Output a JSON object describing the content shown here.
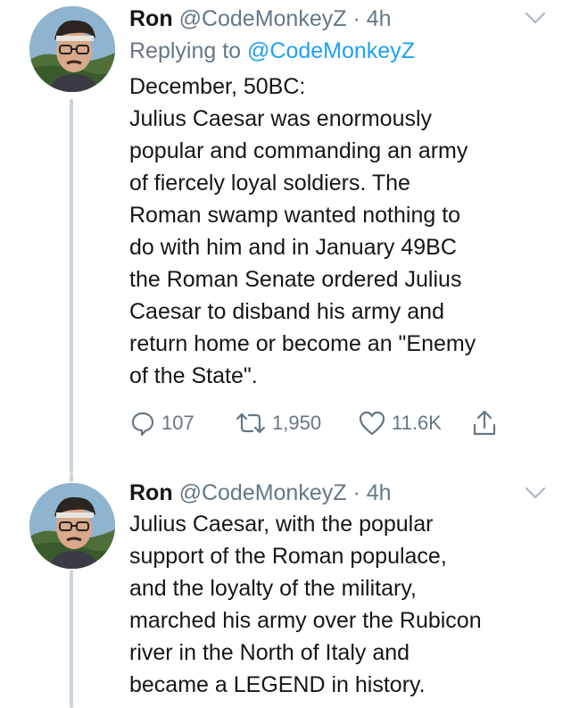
{
  "tweets": [
    {
      "author_name": "Ron",
      "author_handle": "@CodeMonkeyZ",
      "separator": "·",
      "time": "4h",
      "replying_label": "Replying to",
      "replying_handle": "@CodeMonkeyZ",
      "body": "December, 50BC:\nJulius Caesar was enormously\npopular and commanding an army\nof fiercely loyal soldiers. The\nRoman swamp wanted nothing to\ndo with him and in January 49BC\nthe Roman Senate ordered Julius\nCaesar to disband his army and\nreturn home or become an \"Enemy\nof the State\".",
      "actions": {
        "replies": "107",
        "retweets": "1,950",
        "likes": "11.6K"
      }
    },
    {
      "author_name": "Ron",
      "author_handle": "@CodeMonkeyZ",
      "separator": "·",
      "time": "4h",
      "body": "Julius Caesar, with the popular\nsupport of the Roman populace,\nand the loyalty of the military,\nmarched his army over the Rubicon\nriver in the North of Italy and\nbecame a LEGEND in history."
    }
  ],
  "icons": {
    "reply": "speech-bubble-icon",
    "retweet": "retweet-arrows-icon",
    "like": "heart-outline-icon",
    "share": "share-upload-icon",
    "menu": "chevron-down-icon"
  },
  "colors": {
    "text": "#14171a",
    "secondary": "#657786",
    "link": "#1da1f2",
    "thread_line": "#ccd6dd"
  }
}
